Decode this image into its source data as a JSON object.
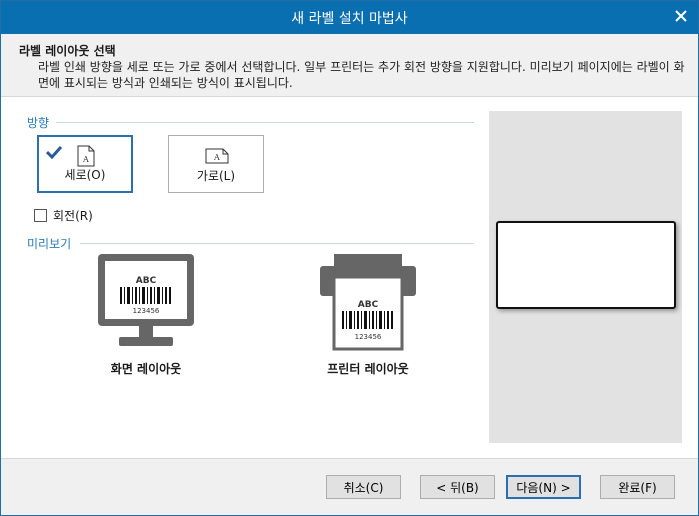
{
  "window": {
    "title": "새 라벨 설치 마법사"
  },
  "header": {
    "title": "라벨 레이아웃 선택",
    "description": "라벨 인쇄 방향을 세로 또는 가로 중에서 선택합니다. 일부 프린터는 추가 회전 방향을 지원합니다. 미리보기 페이지에는 라벨이 화면에 표시되는 방식과 인쇄되는 방식이 표시됩니다."
  },
  "orientation": {
    "section_label": "방향",
    "portrait_label": "세로(O)",
    "landscape_label": "가로(L)",
    "selected": "portrait",
    "rotate_label": "회전(R)",
    "rotate_checked": false
  },
  "preview": {
    "section_label": "미리보기",
    "screen_caption": "화면 레이아웃",
    "printer_caption": "프린터 레이아웃",
    "barcode_text_top": "ABC",
    "barcode_number": "123456"
  },
  "footer": {
    "cancel": "취소(C)",
    "back": "< 뒤(B)",
    "next": "다음(N) >",
    "finish": "완료(F)"
  },
  "colors": {
    "titlebar": "#0a6fb0",
    "accent": "#2a7ab8",
    "panel": "#e2e2e2"
  }
}
